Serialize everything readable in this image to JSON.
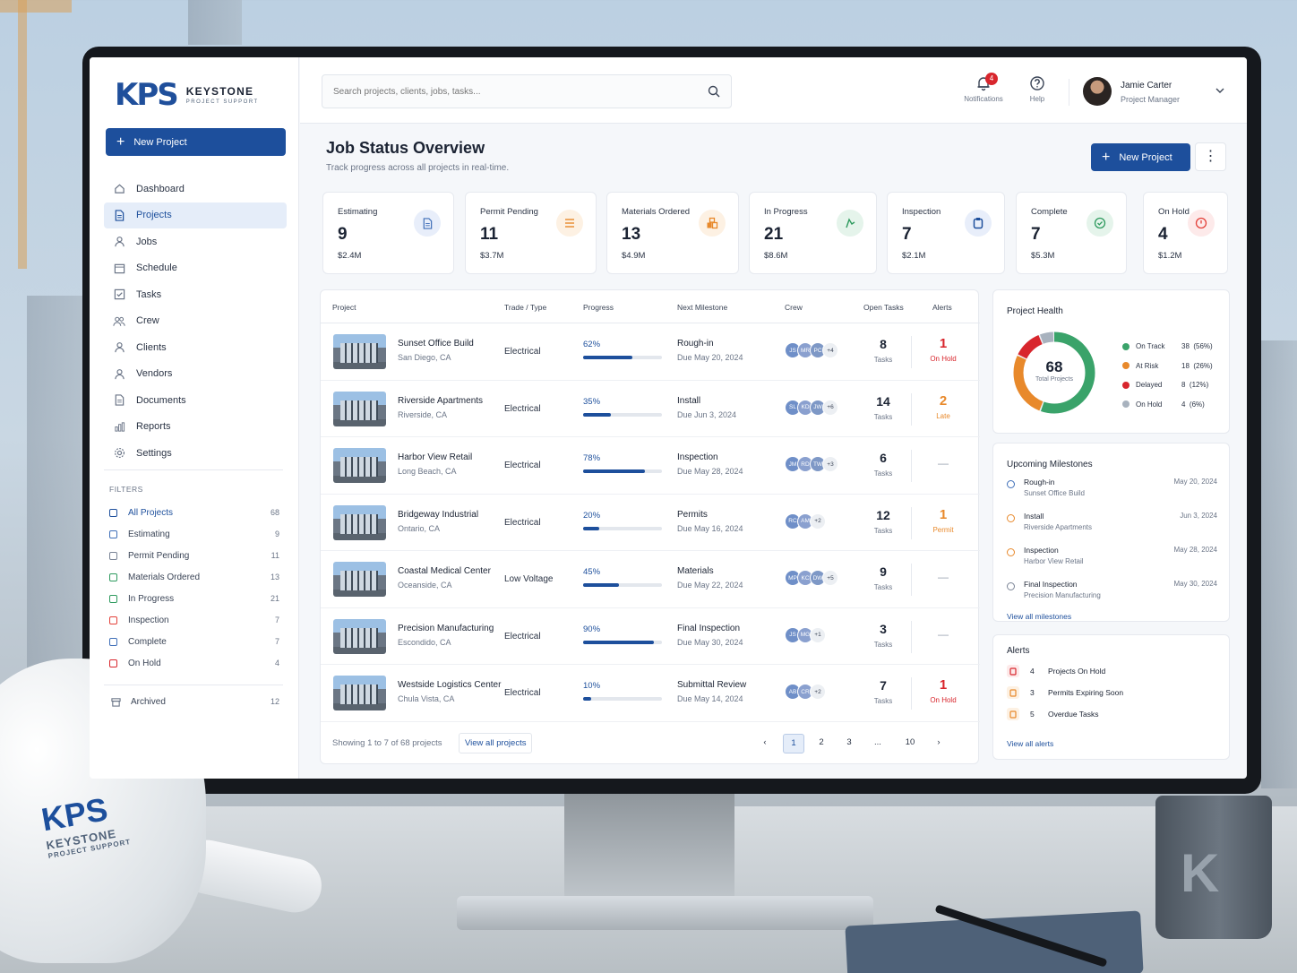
{
  "brand": {
    "mark": "KPS",
    "name": "KEYSTONE",
    "sub": "PROJECT SUPPORT",
    "color": "#1d4f9c"
  },
  "helmet": {
    "mark": "KPS",
    "name": "KEYSTONE",
    "sub": "PROJECT SUPPORT"
  },
  "mug": {
    "mark": "K"
  },
  "sidebar": {
    "new_project": "New Project",
    "items": [
      {
        "label": "Dashboard",
        "icon": "home-icon"
      },
      {
        "label": "Projects",
        "icon": "document-icon",
        "active": true
      },
      {
        "label": "Jobs",
        "icon": "person-icon"
      },
      {
        "label": "Schedule",
        "icon": "calendar-icon"
      },
      {
        "label": "Tasks",
        "icon": "checklist-icon"
      },
      {
        "label": "Crew",
        "icon": "group-icon"
      },
      {
        "label": "Clients",
        "icon": "person-icon"
      },
      {
        "label": "Vendors",
        "icon": "person-icon"
      },
      {
        "label": "Documents",
        "icon": "document-icon"
      },
      {
        "label": "Reports",
        "icon": "chart-icon"
      },
      {
        "label": "Settings",
        "icon": "gear-icon"
      }
    ],
    "filters_title": "FILTERS",
    "filters": [
      {
        "label": "All Projects",
        "count": "68",
        "color": "#1d4f9c"
      },
      {
        "label": "Estimating",
        "count": "9",
        "color": "#3f6fb8"
      },
      {
        "label": "Permit Pending",
        "count": "11",
        "color": "#7a8496"
      },
      {
        "label": "Materials Ordered",
        "count": "13",
        "color": "#2e9a5e"
      },
      {
        "label": "In Progress",
        "count": "21",
        "color": "#2e9a5e"
      },
      {
        "label": "Inspection",
        "count": "7",
        "color": "#e3413a"
      },
      {
        "label": "Complete",
        "count": "7",
        "color": "#3f6fb8"
      },
      {
        "label": "On Hold",
        "count": "4",
        "color": "#d8262d"
      }
    ],
    "archived": {
      "label": "Archived",
      "count": "12"
    }
  },
  "topbar": {
    "search_placeholder": "Search projects, clients, jobs, tasks...",
    "notifications_label": "Notifications",
    "notifications_count": "4",
    "help_label": "Help",
    "user_name": "Jamie Carter",
    "user_role": "Project Manager"
  },
  "main": {
    "title": "Job Status Overview",
    "subtitle": "Track progress across all projects in real-time.",
    "new_project": "New Project",
    "more": "⋮"
  },
  "stats": [
    {
      "label": "Estimating",
      "value": "9",
      "amount": "$2.4M",
      "icon": "document-icon",
      "color": "#3f6fb8",
      "bg": "#e8eefa"
    },
    {
      "label": "Permit Pending",
      "value": "11",
      "amount": "$3.7M",
      "icon": "list-icon",
      "color": "#e8892b",
      "bg": "#fdf1e3"
    },
    {
      "label": "Materials Ordered",
      "value": "13",
      "amount": "$4.9M",
      "icon": "boxes-icon",
      "color": "#e8892b",
      "bg": "#fdf1e3"
    },
    {
      "label": "In Progress",
      "value": "21",
      "amount": "$8.6M",
      "icon": "worker-icon",
      "color": "#2e9a5e",
      "bg": "#e5f4eb"
    },
    {
      "label": "Inspection",
      "value": "7",
      "amount": "$2.1M",
      "icon": "clipboard-icon",
      "color": "#1d4f9c",
      "bg": "#e8eefa"
    },
    {
      "label": "Complete",
      "value": "7",
      "amount": "$5.3M",
      "icon": "check-circle-icon",
      "color": "#2e9a5e",
      "bg": "#e5f4eb"
    },
    {
      "label": "On Hold",
      "value": "4",
      "amount": "$1.2M",
      "icon": "clock-icon",
      "color": "#e3413a",
      "bg": "#fdeaea"
    }
  ],
  "table": {
    "headers": {
      "project": "Project",
      "trade": "Trade / Type",
      "progress": "Progress",
      "milestone": "Next Milestone",
      "crew": "Crew",
      "tasks": "Open Tasks",
      "alerts": "Alerts"
    },
    "tasks_label": "Tasks",
    "rows": [
      {
        "name": "Sunset Office Build",
        "location": "San Diego, CA",
        "trade": "Electrical",
        "progress": 62,
        "progress_text": "62%",
        "milestone": "Rough-in",
        "due": "Due May 20, 2024",
        "crew": [
          "JS",
          "MR",
          "PC"
        ],
        "crew_more": "+4",
        "tasks": "8",
        "alert": "1",
        "alert_label": "On Hold",
        "alert_color": "#d8262d"
      },
      {
        "name": "Riverside Apartments",
        "location": "Riverside, CA",
        "trade": "Electrical",
        "progress": 35,
        "progress_text": "35%",
        "milestone": "Install",
        "due": "Due Jun 3, 2024",
        "crew": [
          "SL",
          "KD",
          "JW"
        ],
        "crew_more": "+6",
        "tasks": "14",
        "alert": "2",
        "alert_label": "Late",
        "alert_color": "#e8892b"
      },
      {
        "name": "Harbor View Retail",
        "location": "Long Beach, CA",
        "trade": "Electrical",
        "progress": 78,
        "progress_text": "78%",
        "milestone": "Inspection",
        "due": "Due May 28, 2024",
        "crew": [
          "JM",
          "RD",
          "TW"
        ],
        "crew_more": "+3",
        "tasks": "6",
        "alert": "",
        "alert_label": "",
        "alert_color": "#9aa3b0"
      },
      {
        "name": "Bridgeway Industrial",
        "location": "Ontario, CA",
        "trade": "Electrical",
        "progress": 20,
        "progress_text": "20%",
        "milestone": "Permits",
        "due": "Due May 16, 2024",
        "crew": [
          "RC",
          "AM"
        ],
        "crew_more": "+2",
        "tasks": "12",
        "alert": "1",
        "alert_label": "Permit",
        "alert_color": "#e8892b"
      },
      {
        "name": "Coastal Medical Center",
        "location": "Oceanside, CA",
        "trade": "Low Voltage",
        "progress": 45,
        "progress_text": "45%",
        "milestone": "Materials",
        "due": "Due May 22, 2024",
        "crew": [
          "MP",
          "KC",
          "DW"
        ],
        "crew_more": "+5",
        "tasks": "9",
        "alert": "",
        "alert_label": "",
        "alert_color": "#9aa3b0"
      },
      {
        "name": "Precision Manufacturing",
        "location": "Escondido, CA",
        "trade": "Electrical",
        "progress": 90,
        "progress_text": "90%",
        "milestone": "Final Inspection",
        "due": "Due May 30, 2024",
        "crew": [
          "JS",
          "MG"
        ],
        "crew_more": "+1",
        "tasks": "3",
        "alert": "",
        "alert_label": "",
        "alert_color": "#9aa3b0"
      },
      {
        "name": "Westside Logistics Center",
        "location": "Chula Vista, CA",
        "trade": "Electrical",
        "progress": 10,
        "progress_text": "10%",
        "milestone": "Submittal Review",
        "due": "Due May 14, 2024",
        "crew": [
          "AB",
          "CR"
        ],
        "crew_more": "+2",
        "tasks": "7",
        "alert": "1",
        "alert_label": "On Hold",
        "alert_color": "#d8262d"
      }
    ],
    "footer": {
      "showing": "Showing 1 to 7 of 68 projects",
      "view_all": "View all projects",
      "pages": [
        "1",
        "2",
        "3",
        "...",
        "10"
      ],
      "prev": "‹",
      "next": "›"
    }
  },
  "health": {
    "title": "Project Health",
    "total": "68",
    "total_label": "Total Projects",
    "legend": [
      {
        "label": "On Track",
        "value": "38",
        "pct": "(56%)",
        "count": 38,
        "color": "#3aa36a"
      },
      {
        "label": "At Risk",
        "value": "18",
        "pct": "(26%)",
        "count": 18,
        "color": "#e8892b"
      },
      {
        "label": "Delayed",
        "value": "8",
        "pct": "(12%)",
        "count": 8,
        "color": "#d8262d"
      },
      {
        "label": "On Hold",
        "value": "4",
        "pct": "(6%)",
        "count": 4,
        "color": "#a8b2be"
      }
    ]
  },
  "milestones": {
    "title": "Upcoming Milestones",
    "items": [
      {
        "title": "Rough-in",
        "project": "Sunset Office Build",
        "date": "May 20, 2024",
        "color": "#3f6fb8"
      },
      {
        "title": "Install",
        "project": "Riverside Apartments",
        "date": "Jun 3, 2024",
        "color": "#e8892b"
      },
      {
        "title": "Inspection",
        "project": "Harbor View Retail",
        "date": "May 28, 2024",
        "color": "#e8892b"
      },
      {
        "title": "Final Inspection",
        "project": "Precision Manufacturing",
        "date": "May 30, 2024",
        "color": "#7a8496"
      }
    ],
    "view_all": "View all milestones"
  },
  "alerts": {
    "title": "Alerts",
    "items": [
      {
        "count": "4",
        "label": "Projects On Hold",
        "color": "#d8262d",
        "bg": "#fdeaea"
      },
      {
        "count": "3",
        "label": "Permits Expiring Soon",
        "color": "#e8892b",
        "bg": "#fdf1e3"
      },
      {
        "count": "5",
        "label": "Overdue Tasks",
        "color": "#e8892b",
        "bg": "#fdf1e3"
      }
    ],
    "view_all": "View all alerts"
  }
}
